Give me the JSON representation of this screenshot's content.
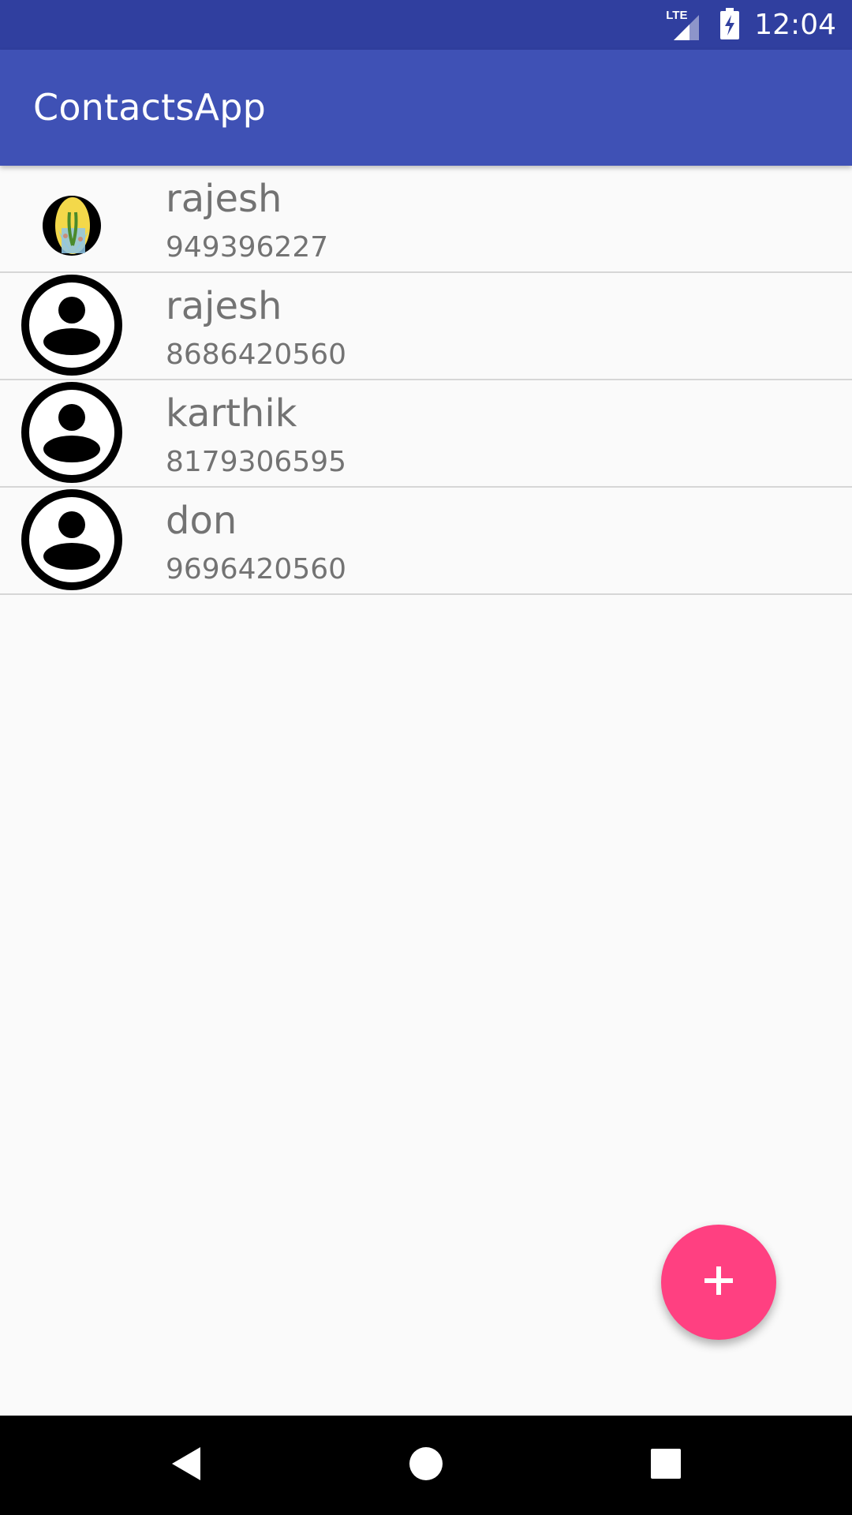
{
  "status_bar": {
    "network_label": "LTE",
    "time": "12:04",
    "icons": [
      "lte-signal-icon",
      "battery-charging-icon"
    ]
  },
  "app_bar": {
    "title": "ContactsApp"
  },
  "contacts": [
    {
      "name": "rajesh",
      "phone": "949396227",
      "avatar": "photo"
    },
    {
      "name": "rajesh",
      "phone": "8686420560",
      "avatar": "default-person-icon"
    },
    {
      "name": "karthik",
      "phone": "8179306595",
      "avatar": "default-person-icon"
    },
    {
      "name": "don",
      "phone": "9696420560",
      "avatar": "default-person-icon"
    }
  ],
  "fab": {
    "icon": "plus-icon",
    "color": "#ff4081"
  },
  "nav_bar": {
    "icons": [
      "back-icon",
      "home-icon",
      "recents-icon"
    ]
  },
  "colors": {
    "status_bar": "#303f9f",
    "app_bar": "#3f51b5",
    "background": "#fafafa",
    "text_secondary": "#737373",
    "accent": "#ff4081"
  }
}
